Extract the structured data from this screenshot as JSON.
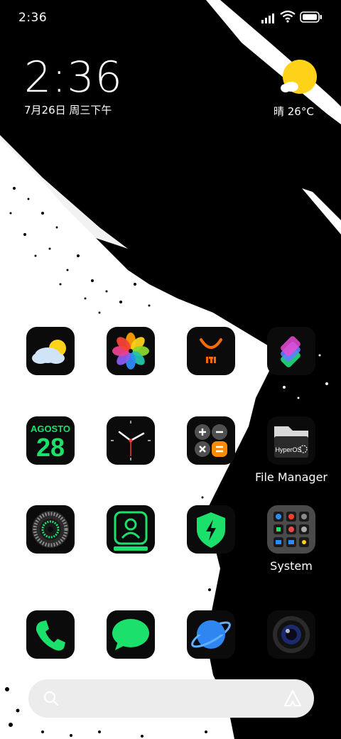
{
  "status_bar": {
    "time": "2:36",
    "icons": [
      "signal-icon",
      "wifi-icon",
      "battery-icon"
    ]
  },
  "clock_widget": {
    "time": "2:36",
    "date": "7月26日 周三下午"
  },
  "weather_widget": {
    "icon": "partly-cloudy-sun-icon",
    "text": "晴 26°C"
  },
  "apps": [
    {
      "icon": "weather-app-icon",
      "label": ""
    },
    {
      "icon": "photos-app-icon",
      "label": ""
    },
    {
      "icon": "mi-store-app-icon",
      "label": ""
    },
    {
      "icon": "shortcuts-app-icon",
      "label": ""
    },
    {
      "icon": "calendar-app-icon",
      "label": "",
      "calendar_month": "AGOSTO",
      "calendar_day": "28"
    },
    {
      "icon": "clock-app-icon",
      "label": ""
    },
    {
      "icon": "calculator-app-icon",
      "label": ""
    },
    {
      "icon": "file-manager-app-icon",
      "label": "File Manager",
      "badge_text": "HyperOS"
    },
    {
      "icon": "settings-app-icon",
      "label": ""
    },
    {
      "icon": "contacts-app-icon",
      "label": ""
    },
    {
      "icon": "security-app-icon",
      "label": ""
    },
    {
      "icon": "system-folder-icon",
      "label": "System"
    },
    {
      "icon": "phone-app-icon",
      "label": ""
    },
    {
      "icon": "messages-app-icon",
      "label": ""
    },
    {
      "icon": "browser-app-icon",
      "label": ""
    },
    {
      "icon": "camera-app-icon",
      "label": ""
    }
  ],
  "search_bar": {
    "left_icon": "search-icon",
    "right_icon": "assistant-icon"
  },
  "colors": {
    "accent_green": "#1be06b",
    "mi_orange": "#ff6a00",
    "weather_sun": "#ffd21a",
    "background_black": "#000000"
  }
}
